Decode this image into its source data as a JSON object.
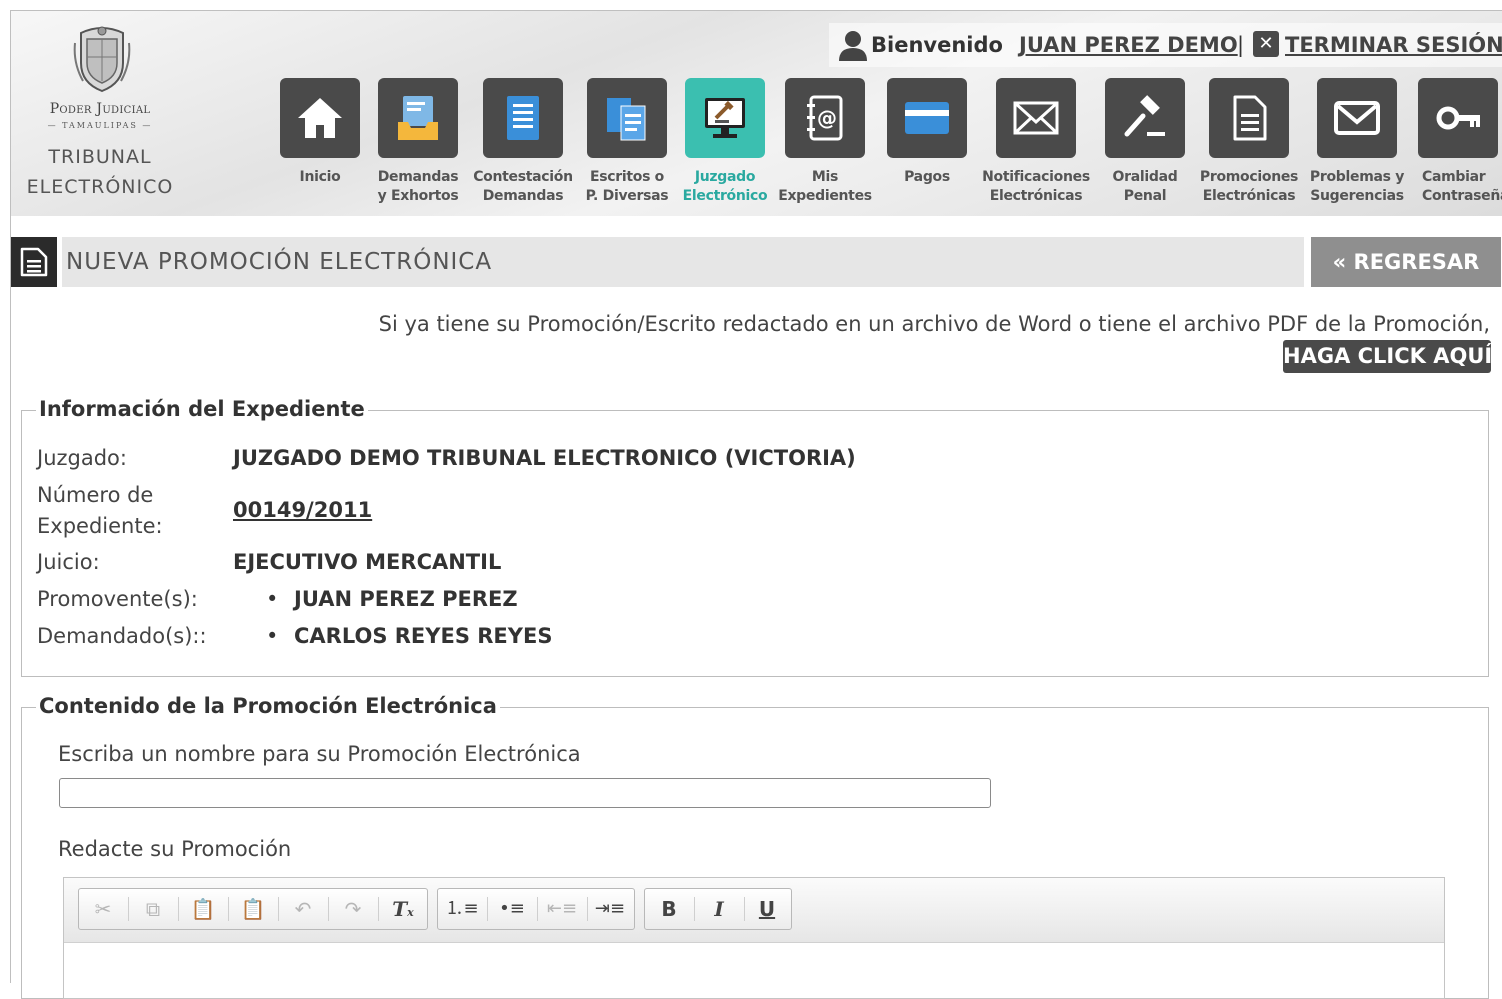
{
  "header": {
    "logo": {
      "line1": "Poder Judicial",
      "line2": "— TAMAULIPAS —",
      "line3": "TRIBUNAL",
      "line4": "ELECTRÓNICO"
    },
    "welcome": "Bienvenido",
    "username": "JUAN PEREZ DEMO",
    "separator": "|",
    "logout_label": "TERMINAR SESIÓN",
    "nav": [
      {
        "l1": "Inicio",
        "l2": "",
        "icon": "home-icon",
        "active": false
      },
      {
        "l1": "Demandas",
        "l2": "y Exhortos",
        "icon": "inbox-tray-icon",
        "active": false
      },
      {
        "l1": "Contestación",
        "l2": "Demandas",
        "icon": "document-list-icon",
        "active": false
      },
      {
        "l1": "Escritos o",
        "l2": "P. Diversas",
        "icon": "documents-icon",
        "active": false
      },
      {
        "l1": "Juzgado",
        "l2": "Electrónico",
        "icon": "gavel-monitor-icon",
        "active": true
      },
      {
        "l1": "Mis",
        "l2": "Expedientes",
        "icon": "address-book-icon",
        "active": false
      },
      {
        "l1": "Pagos",
        "l2": "",
        "icon": "credit-card-icon",
        "active": false
      },
      {
        "l1": "Notificaciones",
        "l2": "Electrónicas",
        "icon": "envelope-open-icon",
        "active": false
      },
      {
        "l1": "Oralidad",
        "l2": "Penal",
        "icon": "gavel-icon",
        "active": false
      },
      {
        "l1": "Promociones",
        "l2": "Electrónicas",
        "icon": "file-text-icon",
        "active": false
      },
      {
        "l1": "Problemas y",
        "l2": "Sugerencias",
        "icon": "envelope-icon",
        "active": false
      },
      {
        "l1": "Cambiar",
        "l2": "Contraseña",
        "icon": "key-icon",
        "active": false
      }
    ]
  },
  "page": {
    "title": "NUEVA PROMOCIÓN ELECTRÓNICA",
    "back_label": "« REGRESAR",
    "notice": "Si ya tiene su Promoción/Escrito redactado en un archivo de Word o tiene el archivo PDF de la Promoción,",
    "click_here_label": "HAGA CLICK AQUÍ"
  },
  "expediente": {
    "legend": "Información del Expediente",
    "juzgado_label": "Juzgado:",
    "juzgado_value": "JUZGADO DEMO TRIBUNAL ELECTRONICO (VICTORIA)",
    "numero_label_1": "Número de",
    "numero_label_2": "Expediente:",
    "numero_value": "00149/2011",
    "juicio_label": "Juicio:",
    "juicio_value": "EJECUTIVO MERCANTIL",
    "promovente_label": "Promovente(s):",
    "promovente_value": "JUAN PEREZ PEREZ",
    "demandado_label": "Demandado(s)::",
    "demandado_value": "CARLOS REYES REYES"
  },
  "contenido": {
    "legend": "Contenido de la Promoción Electrónica",
    "name_label": "Escriba un nombre para su Promoción Electrónica",
    "name_value": "",
    "editor_label": "Redacte su Promoción"
  },
  "colors": {
    "tile": "#4a4a4a",
    "tile_active": "#3bbfb0",
    "accent_text": "#2aa9a0"
  }
}
